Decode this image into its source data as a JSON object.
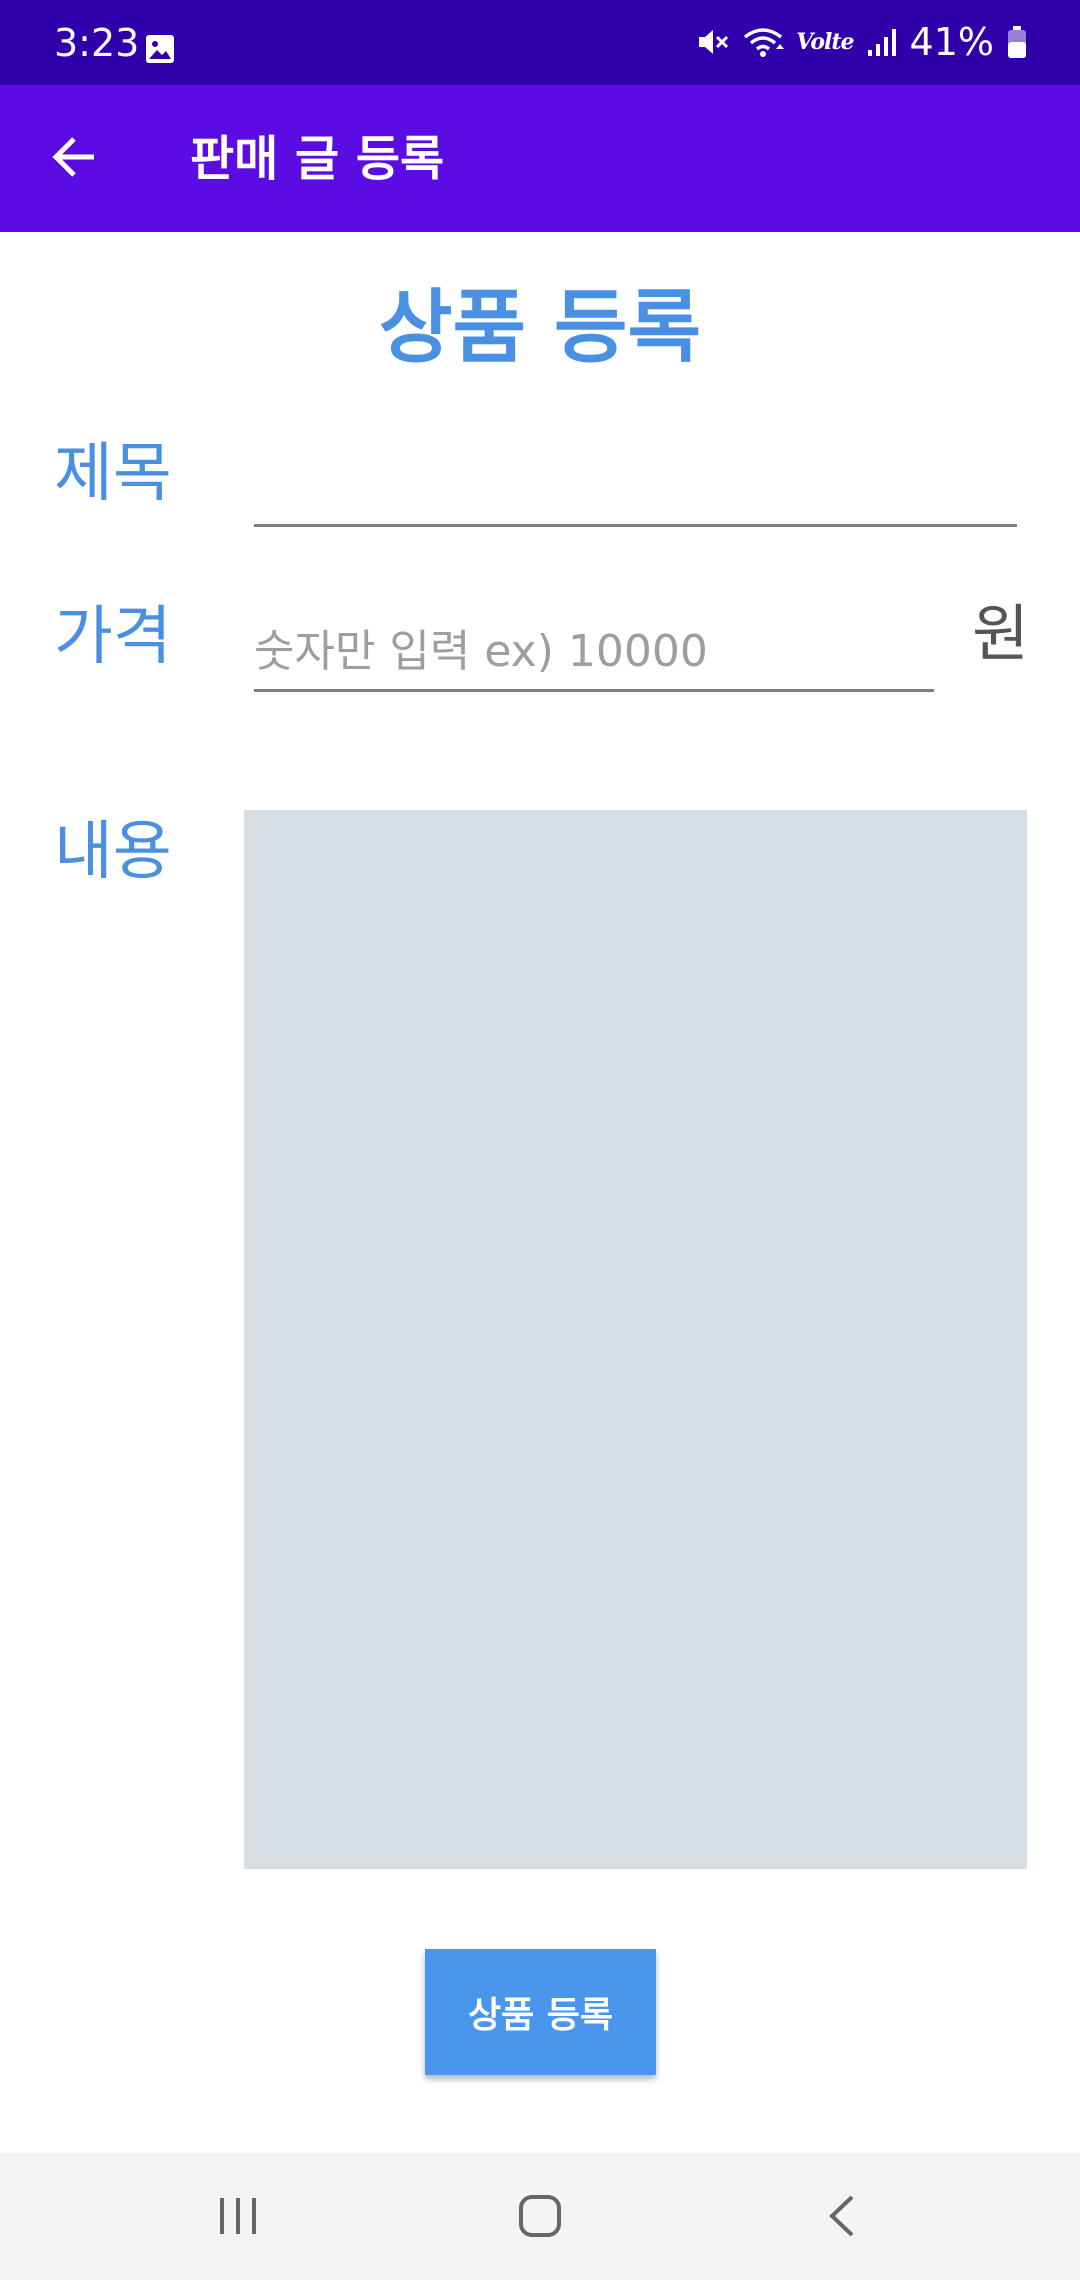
{
  "status_bar": {
    "time": "3:23",
    "network": "Volte",
    "battery": "41%",
    "icons": [
      "gallery-icon",
      "mute-icon",
      "wifi-icon",
      "volte-icon",
      "signal-icon",
      "battery-icon"
    ]
  },
  "app_bar": {
    "title": "판매 글 등록",
    "back_icon": "arrow-left-icon"
  },
  "form": {
    "heading": "상품 등록",
    "title_label": "제목",
    "title_value": "",
    "price_label": "가격",
    "price_value": "",
    "price_placeholder": "숫자만 입력 ex) 10000",
    "price_unit": "원",
    "content_label": "내용",
    "content_value": "",
    "submit_label": "상품 등록"
  },
  "navigation_bar": {
    "icons": [
      "recents-icon",
      "home-icon",
      "back-icon"
    ]
  },
  "colors": {
    "status_bar": "#3001aa",
    "app_bar": "#5b0ce3",
    "accent_label": "#4a90e2",
    "button": "#4a96ec",
    "content_background": "#d6dee4",
    "nav_bar": "#f4f4f4"
  }
}
